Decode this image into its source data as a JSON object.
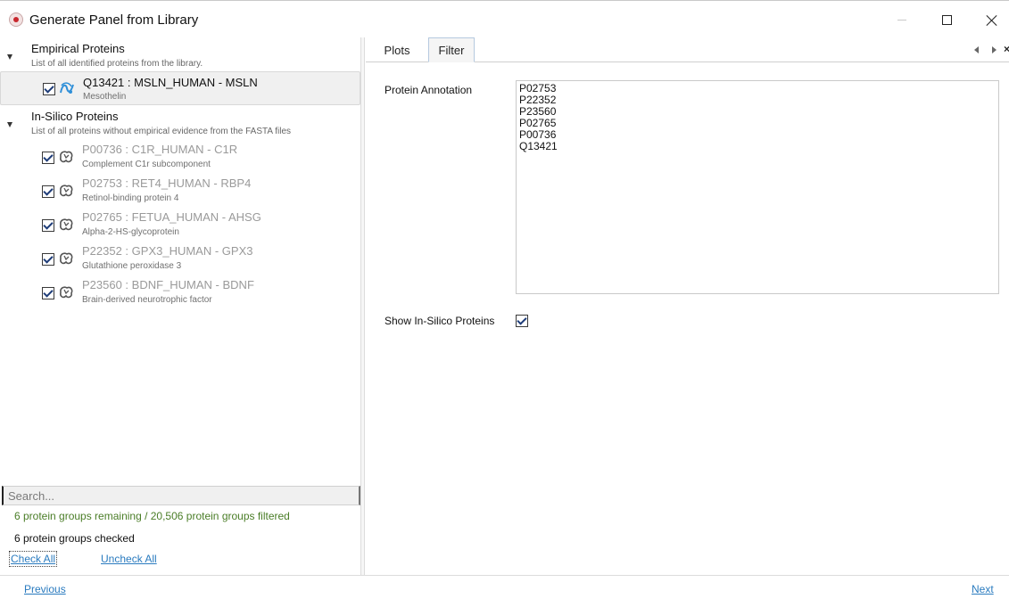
{
  "window": {
    "title": "Generate Panel from Library"
  },
  "library": {
    "empirical": {
      "title": "Empirical Proteins",
      "subtitle": "List of all identified proteins from the library.",
      "items": [
        {
          "title": "Q13421 : MSLN_HUMAN - MSLN",
          "description": "Mesothelin",
          "checked": true
        }
      ]
    },
    "insilico": {
      "title": "In-Silico Proteins",
      "subtitle": "List of all proteins without empirical evidence from the FASTA files",
      "items": [
        {
          "title": "P00736 : C1R_HUMAN - C1R",
          "description": "Complement C1r subcomponent",
          "checked": true
        },
        {
          "title": "P02753 : RET4_HUMAN - RBP4",
          "description": "Retinol-binding protein 4",
          "checked": true
        },
        {
          "title": "P02765 : FETUA_HUMAN - AHSG",
          "description": "Alpha-2-HS-glycoprotein",
          "checked": true
        },
        {
          "title": "P22352 : GPX3_HUMAN - GPX3",
          "description": "Glutathione peroxidase 3",
          "checked": true
        },
        {
          "title": "P23560 : BDNF_HUMAN - BDNF",
          "description": "Brain-derived neurotrophic factor",
          "checked": true
        }
      ]
    }
  },
  "search": {
    "placeholder": "Search..."
  },
  "status": {
    "remaining": "6 protein groups remaining / 20,506 protein groups filtered",
    "checked": "6 protein groups checked"
  },
  "actions": {
    "check_all": "Check All",
    "uncheck_all": "Uncheck All",
    "previous": "Previous",
    "next": "Next"
  },
  "tabs": {
    "plots": "Plots",
    "filter": "Filter",
    "active": "Filter"
  },
  "filter": {
    "annotation_label": "Protein Annotation",
    "annotation_lines": [
      "P02753",
      "P22352",
      "P23560",
      "P02765",
      "P00736",
      "Q13421"
    ],
    "show_insilico_label": "Show In-Silico Proteins",
    "show_insilico_checked": true
  },
  "colors": {
    "status_green": "#4a7d27",
    "link_blue": "#2a7bbf",
    "insilico_text": "#9a9a9a",
    "empirical_icon": "#2f8fd8"
  },
  "icons": {
    "empirical_item": "empirical-protein-icon",
    "insilico_item": "insilico-protein-icon"
  }
}
